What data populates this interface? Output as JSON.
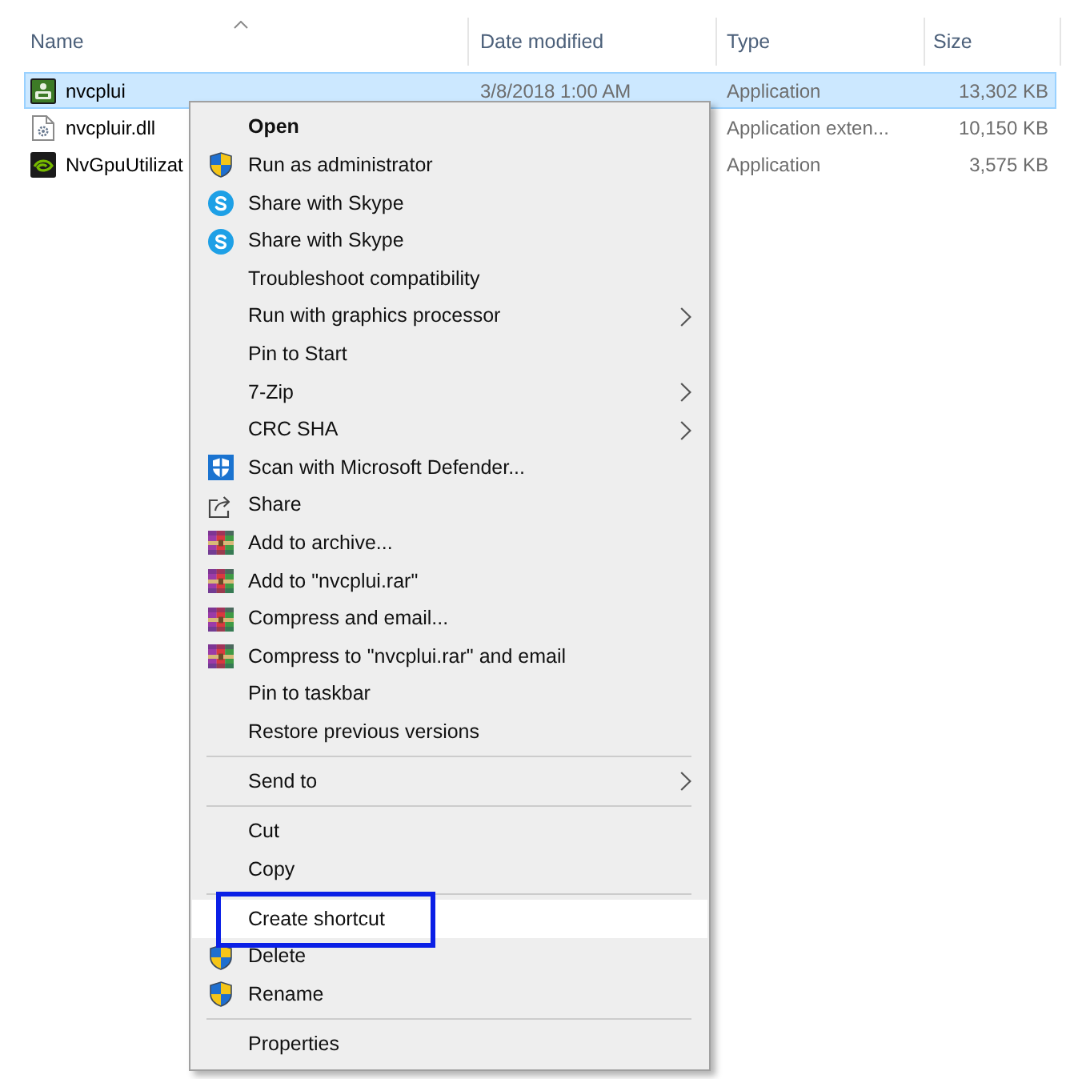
{
  "columns": [
    {
      "label": "Name",
      "sorted": true
    },
    {
      "label": "Date modified",
      "sorted": false
    },
    {
      "label": "Type",
      "sorted": false
    },
    {
      "label": "Size",
      "sorted": false
    }
  ],
  "files": [
    {
      "kind": "app",
      "name": "nvcplui",
      "date_modified": "3/8/2018 1:00 AM",
      "type": "Application",
      "size": "13,302 KB",
      "selected": true
    },
    {
      "kind": "dll",
      "name": "nvcpluir.dll",
      "type": "Application exten...",
      "size": "10,150 KB",
      "selected": false
    },
    {
      "kind": "gpu",
      "name": "NvGpuUtilizat",
      "type": "Application",
      "size": "3,575 KB",
      "selected": false
    }
  ],
  "context_menu": {
    "items": [
      {
        "kind": "plain",
        "label": "Open",
        "default": true,
        "submenu": false,
        "selected": false,
        "outlined": false
      },
      {
        "kind": "shield",
        "label": "Run as administrator",
        "default": false,
        "submenu": false,
        "selected": false,
        "outlined": false
      },
      {
        "kind": "skype",
        "label": "Share with Skype",
        "default": false,
        "submenu": false,
        "selected": false,
        "outlined": false
      },
      {
        "kind": "skype",
        "label": "Share with Skype",
        "default": false,
        "submenu": false,
        "selected": false,
        "outlined": false
      },
      {
        "kind": "plain",
        "label": "Troubleshoot compatibility",
        "default": false,
        "submenu": false,
        "selected": false,
        "outlined": false
      },
      {
        "kind": "plain",
        "label": "Run with graphics processor",
        "default": false,
        "submenu": true,
        "selected": false,
        "outlined": false
      },
      {
        "kind": "plain",
        "label": "Pin to Start",
        "default": false,
        "submenu": false,
        "selected": false,
        "outlined": false
      },
      {
        "kind": "plain",
        "label": "7-Zip",
        "default": false,
        "submenu": true,
        "selected": false,
        "outlined": false
      },
      {
        "kind": "plain",
        "label": "CRC SHA",
        "default": false,
        "submenu": true,
        "selected": false,
        "outlined": false
      },
      {
        "kind": "defender",
        "label": "Scan with Microsoft Defender...",
        "default": false,
        "submenu": false,
        "selected": false,
        "outlined": false
      },
      {
        "kind": "share",
        "label": "Share",
        "default": false,
        "submenu": false,
        "selected": false,
        "outlined": false
      },
      {
        "kind": "archive",
        "label": "Add to archive...",
        "default": false,
        "submenu": false,
        "selected": false,
        "outlined": false
      },
      {
        "kind": "archive",
        "label": "Add to \"nvcplui.rar\"",
        "default": false,
        "submenu": false,
        "selected": false,
        "outlined": false
      },
      {
        "kind": "archive",
        "label": "Compress and email...",
        "default": false,
        "submenu": false,
        "selected": false,
        "outlined": false
      },
      {
        "kind": "archive",
        "label": "Compress to \"nvcplui.rar\" and email",
        "default": false,
        "submenu": false,
        "selected": false,
        "outlined": false
      },
      {
        "kind": "plain",
        "label": "Pin to taskbar",
        "default": false,
        "submenu": false,
        "selected": false,
        "outlined": false
      },
      {
        "kind": "plain",
        "label": "Restore previous versions",
        "default": false,
        "submenu": false,
        "selected": false,
        "outlined": false
      },
      {
        "kind": "separator"
      },
      {
        "kind": "plain",
        "label": "Send to",
        "default": false,
        "submenu": true,
        "selected": false,
        "outlined": false
      },
      {
        "kind": "separator"
      },
      {
        "kind": "plain",
        "label": "Cut",
        "default": false,
        "submenu": false,
        "selected": false,
        "outlined": false
      },
      {
        "kind": "plain",
        "label": "Copy",
        "default": false,
        "submenu": false,
        "selected": false,
        "outlined": false
      },
      {
        "kind": "separator"
      },
      {
        "kind": "plain",
        "label": "Create shortcut",
        "default": false,
        "submenu": false,
        "selected": true,
        "outlined": true
      },
      {
        "kind": "shield",
        "label": "Delete",
        "default": false,
        "submenu": false,
        "selected": false,
        "outlined": false
      },
      {
        "kind": "shield",
        "label": "Rename",
        "default": false,
        "submenu": false,
        "selected": false,
        "outlined": false
      },
      {
        "kind": "separator"
      },
      {
        "kind": "plain",
        "label": "Properties",
        "default": false,
        "submenu": false,
        "selected": false,
        "outlined": false
      }
    ]
  }
}
